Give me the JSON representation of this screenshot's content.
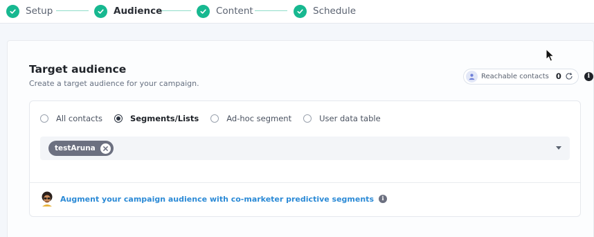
{
  "stepper": {
    "steps": [
      {
        "label": "Setup",
        "state": "complete"
      },
      {
        "label": "Audience",
        "state": "active"
      },
      {
        "label": "Content",
        "state": "complete"
      },
      {
        "label": "Schedule",
        "state": "complete"
      }
    ]
  },
  "card": {
    "title": "Target audience",
    "subtitle": "Create a target audience for your campaign.",
    "reachable": {
      "label": "Reachable contacts",
      "count": "0"
    }
  },
  "audience_type": {
    "options": [
      {
        "label": "All contacts",
        "selected": false
      },
      {
        "label": "Segments/Lists",
        "selected": true
      },
      {
        "label": "Ad-hoc segment",
        "selected": false
      },
      {
        "label": "User data table",
        "selected": false
      }
    ]
  },
  "segment_select": {
    "chips": [
      "testAruna"
    ]
  },
  "augment": {
    "link": "Augment your campaign audience with co-marketer predictive segments"
  },
  "colors": {
    "accent_green": "#17b890",
    "link_blue": "#2b8ad6",
    "chip_gray": "#6c7080"
  },
  "icons": [
    "check-icon",
    "user-icon",
    "refresh-icon",
    "info-icon",
    "close-icon",
    "chevron-down-icon",
    "avatar",
    "mouse-cursor"
  ]
}
